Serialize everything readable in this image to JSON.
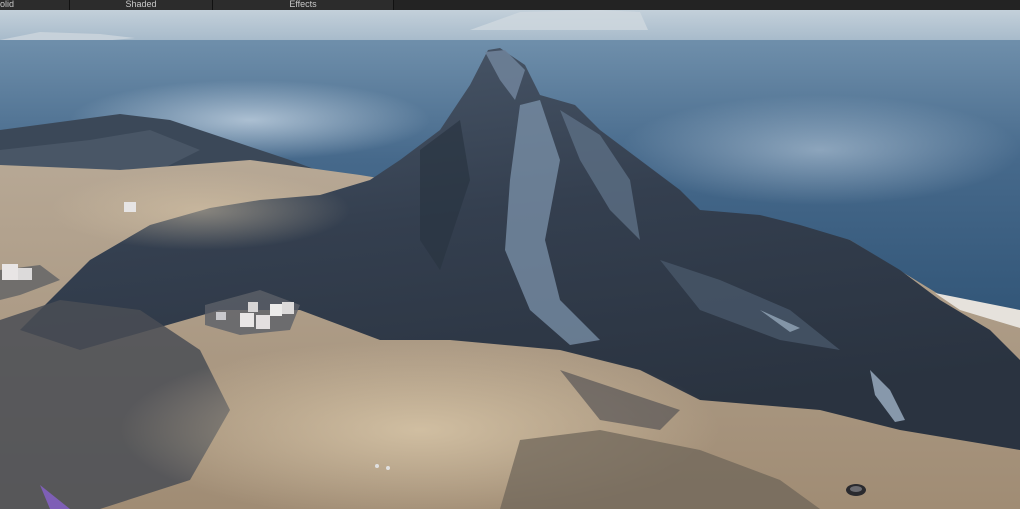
{
  "toolbar": {
    "buttons": [
      {
        "id": "solid",
        "label": "olid"
      },
      {
        "id": "shaded",
        "label": "Shaded"
      },
      {
        "id": "effects",
        "label": "Effects"
      }
    ]
  },
  "scene": {
    "colors": {
      "sky": "#a9bccb",
      "sea": "#3f6485",
      "sea_highlight": "#7f9fbb",
      "mountain": "#3d4a5a",
      "mountain_dark": "#273140",
      "snow": "#8fa6bd",
      "sand": "#bfae98",
      "dust": "#c9b89e"
    }
  }
}
